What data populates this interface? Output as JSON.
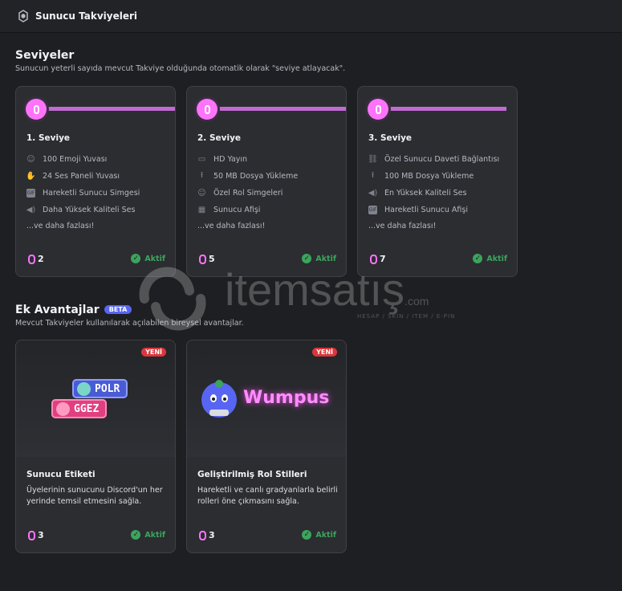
{
  "header": {
    "title": "Sunucu Takviyeleri",
    "icon": "boost-gem-icon"
  },
  "levels": {
    "title": "Seviyeler",
    "subtitle": "Sunucun yeterli sayıda mevcut Takviye olduğunda otomatik olarak \"seviye atlayacak\".",
    "tiers": [
      {
        "name": "1. Seviye",
        "perks": [
          {
            "icon": "emoji-icon",
            "label": "100 Emoji Yuvası"
          },
          {
            "icon": "soundboard-icon",
            "label": "24 Ses Paneli Yuvası"
          },
          {
            "icon": "gif-icon",
            "label": "Hareketli Sunucu Simgesi"
          },
          {
            "icon": "speaker-icon",
            "label": "Daha Yüksek Kaliteli Ses"
          }
        ],
        "more": "...ve daha fazlası!",
        "count": "2",
        "status": "Aktif"
      },
      {
        "name": "2. Seviye",
        "perks": [
          {
            "icon": "screen-share-icon",
            "label": "HD Yayın"
          },
          {
            "icon": "upload-icon",
            "label": "50 MB Dosya Yükleme"
          },
          {
            "icon": "emoji-icon",
            "label": "Özel Rol Simgeleri"
          },
          {
            "icon": "grid-icon",
            "label": "Sunucu Afişi"
          }
        ],
        "more": "...ve daha fazlası!",
        "count": "5",
        "status": "Aktif"
      },
      {
        "name": "3. Seviye",
        "perks": [
          {
            "icon": "link-icon",
            "label": "Özel Sunucu Daveti Bağlantısı"
          },
          {
            "icon": "upload-icon",
            "label": "100 MB Dosya Yükleme"
          },
          {
            "icon": "speaker-icon",
            "label": "En Yüksek Kaliteli Ses"
          },
          {
            "icon": "gif-icon",
            "label": "Hareketli Sunucu Afişi"
          }
        ],
        "more": "...ve daha fazlası!",
        "count": "7",
        "status": "Aktif"
      }
    ]
  },
  "extras": {
    "title": "Ek Avantajlar",
    "badge": "BETA",
    "subtitle": "Mevcut Takviyeler kullanılarak açılabilen bireysel avantajlar.",
    "cards": [
      {
        "new_badge": "YENİ",
        "tag_top": "POLR",
        "tag_bottom": "GGEZ",
        "title": "Sunucu Etiketi",
        "desc": "Üyelerinin sunucunu Discord'un her yerinde temsil etmesini sağla.",
        "count": "3",
        "status": "Aktif"
      },
      {
        "new_badge": "YENİ",
        "wumpus": "Wumpus",
        "title": "Geliştirilmiş Rol Stilleri",
        "desc": "Hareketli ve canlı gradyanlarla belirli rolleri öne çıkmasını sağla.",
        "count": "3",
        "status": "Aktif"
      }
    ]
  },
  "watermark": {
    "text": "itemsatış",
    "sub": "HESAP / SKIN / ITEM / E-PIN",
    "domain": ".com"
  },
  "colors": {
    "accent": "#ff73fa",
    "active": "#3ba55c",
    "new": "#da373c",
    "beta": "#5865f2"
  }
}
